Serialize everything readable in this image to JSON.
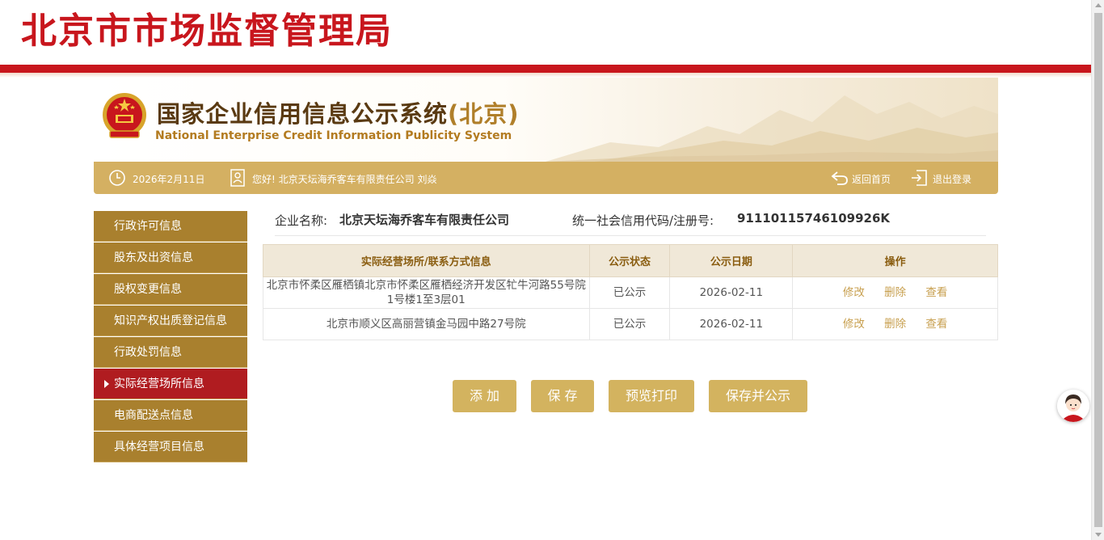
{
  "header": {
    "title": "北京市市场监督管理局"
  },
  "banner": {
    "title": "国家企业信用信息公示系统",
    "region": "(北京)",
    "subtitle": "National Enterprise Credit Information Publicity System"
  },
  "infobar": {
    "date": "2026年2月11日",
    "welcome": "您好!  北京天坛海乔客车有限责任公司  刘焱",
    "home_label": "返回首页",
    "logout_label": "退出登录"
  },
  "sidebar": {
    "items": [
      {
        "label": "行政许可信息"
      },
      {
        "label": "股东及出资信息"
      },
      {
        "label": "股权变更信息"
      },
      {
        "label": "知识产权出质登记信息"
      },
      {
        "label": "行政处罚信息"
      },
      {
        "label": "实际经营场所信息"
      },
      {
        "label": "电商配送点信息"
      },
      {
        "label": "具体经营项目信息"
      }
    ],
    "active_index": 5
  },
  "company": {
    "name_label": "企业名称:",
    "name": "北京天坛海乔客车有限责任公司",
    "code_label": "统一社会信用代码/注册号:",
    "code": "91110115746109926K"
  },
  "table": {
    "headers": [
      "实际经营场所/联系方式信息",
      "公示状态",
      "公示日期",
      "操作"
    ],
    "rows": [
      {
        "address": "北京市怀柔区雁栖镇北京市怀柔区雁栖经济开发区牤牛河路55号院1号楼1至3层01",
        "status": "已公示",
        "date": "2026-02-11"
      },
      {
        "address": "北京市顺义区高丽营镇金马园中路27号院",
        "status": "已公示",
        "date": "2026-02-11"
      }
    ],
    "ops": {
      "edit": "修改",
      "delete": "删除",
      "view": "查看"
    }
  },
  "buttons": {
    "add": "添 加",
    "save": "保 存",
    "preview_print": "预览打印",
    "save_publish": "保存并公示"
  },
  "colors": {
    "brand_red": "#c8161d",
    "gold": "#d4b062",
    "sidebar_gold": "#a9802e",
    "active_red": "#b01c20"
  }
}
